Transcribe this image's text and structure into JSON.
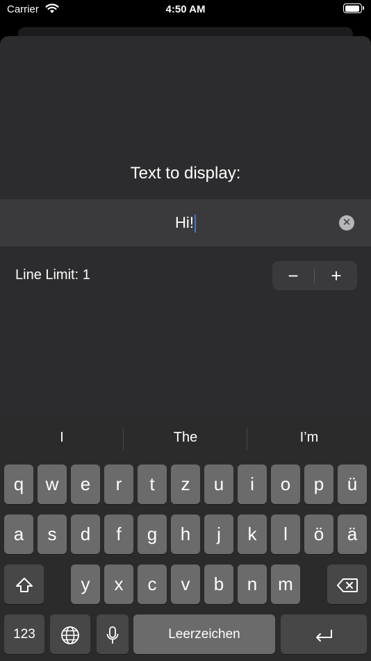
{
  "status": {
    "carrier": "Carrier",
    "time": "4:50 AM"
  },
  "form": {
    "prompt": "Text to display:",
    "text_value": "Hi!",
    "line_limit_label": "Line Limit: 1",
    "stepper_minus": "−",
    "stepper_plus": "+",
    "clear_symbol": "✕"
  },
  "keyboard": {
    "suggestions": [
      "I",
      "The",
      "I’m"
    ],
    "row1": [
      "q",
      "w",
      "e",
      "r",
      "t",
      "z",
      "u",
      "i",
      "o",
      "p",
      "ü"
    ],
    "row2": [
      "a",
      "s",
      "d",
      "f",
      "g",
      "h",
      "j",
      "k",
      "l",
      "ö",
      "ä"
    ],
    "row3": [
      "y",
      "x",
      "c",
      "v",
      "b",
      "n",
      "m"
    ],
    "numbers_label": "123",
    "space_label": "Leerzeichen",
    "shift_icon": "shift-icon",
    "delete_icon": "delete-icon",
    "globe_icon": "globe-icon",
    "mic_icon": "microphone-icon",
    "return_icon": "return-icon"
  }
}
